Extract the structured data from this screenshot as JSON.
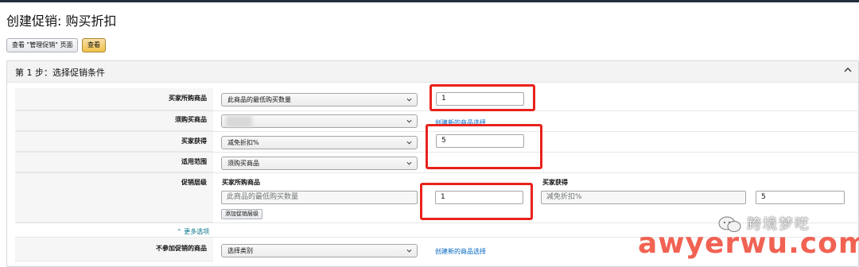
{
  "page": {
    "title": "创建促销: 购买折扣"
  },
  "toolbar": {
    "manage_label": "查看 \"管理促销\" 页面",
    "view_label": "查看"
  },
  "panel": {
    "title": "第 1 步：选择促销条件"
  },
  "rows": {
    "buyer_purchases": {
      "label": "买家所购商品",
      "select": "此商品的最低购买数量",
      "value": "1"
    },
    "required_items": {
      "label": "须购买商品",
      "select": "",
      "link": "创建新的商品选择"
    },
    "buyer_gets": {
      "label": "买家获得",
      "select": "减免折扣%",
      "value": "5"
    },
    "applies_to": {
      "label": "适用范围",
      "select": "须购买商品"
    },
    "tiers": {
      "label": "促销层级",
      "col_purchases": "买家所购商品",
      "col_gets": "买家获得",
      "purchase_placeholder": "此商品的最低购买数量",
      "purchase_value": "1",
      "gets_placeholder": "减免折扣%",
      "gets_value": "5",
      "add_tier": "添加促销层级"
    },
    "more_options": "更多选项",
    "excluded": {
      "label": "不参加促销的商品",
      "select": "选择类别",
      "link": "创建新的商品选择"
    }
  },
  "watermark": {
    "name": "跨境梦呓",
    "url": "awyerwu.com"
  },
  "colors": {
    "highlight": "#e8221b",
    "link": "#0066c0",
    "accent_button": "#f0c14b"
  }
}
